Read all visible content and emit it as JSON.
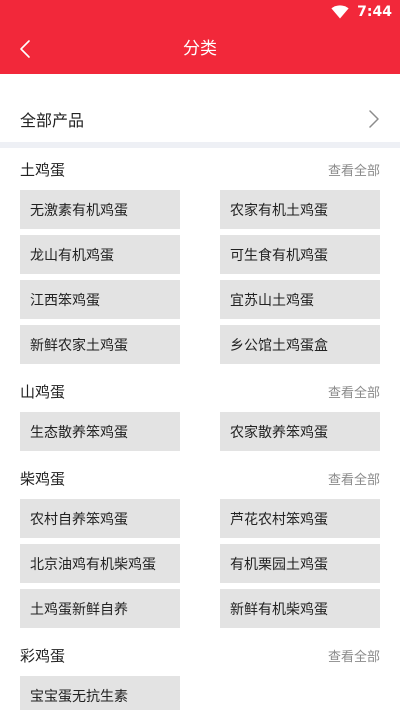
{
  "status_bar": {
    "time": "7:44"
  },
  "header": {
    "title": "分类"
  },
  "all_products": {
    "label": "全部产品"
  },
  "view_all_label": "查看全部",
  "categories": [
    {
      "title": "土鸡蛋",
      "items": [
        "无激素有机鸡蛋",
        "农家有机土鸡蛋",
        "龙山有机鸡蛋",
        "可生食有机鸡蛋",
        "江西笨鸡蛋",
        "宜苏山土鸡蛋",
        "新鲜农家土鸡蛋",
        "乡公馆土鸡蛋盒"
      ]
    },
    {
      "title": "山鸡蛋",
      "items": [
        "生态散养笨鸡蛋",
        "农家散养笨鸡蛋"
      ]
    },
    {
      "title": "柴鸡蛋",
      "items": [
        "农村自养笨鸡蛋",
        "芦花农村笨鸡蛋",
        "北京油鸡有机柴鸡蛋",
        "有机栗园土鸡蛋",
        "土鸡蛋新鲜自养",
        "新鲜有机柴鸡蛋"
      ]
    },
    {
      "title": "彩鸡蛋",
      "items": [
        "宝宝蛋无抗生素"
      ]
    }
  ],
  "colors": {
    "header_bg": "#f2283a",
    "item_bg": "#e3e3e3",
    "divider": "#eef0f5"
  },
  "icons": {
    "back": "back-arrow-icon",
    "wifi": "wifi-icon",
    "chevron": "chevron-right-icon"
  }
}
